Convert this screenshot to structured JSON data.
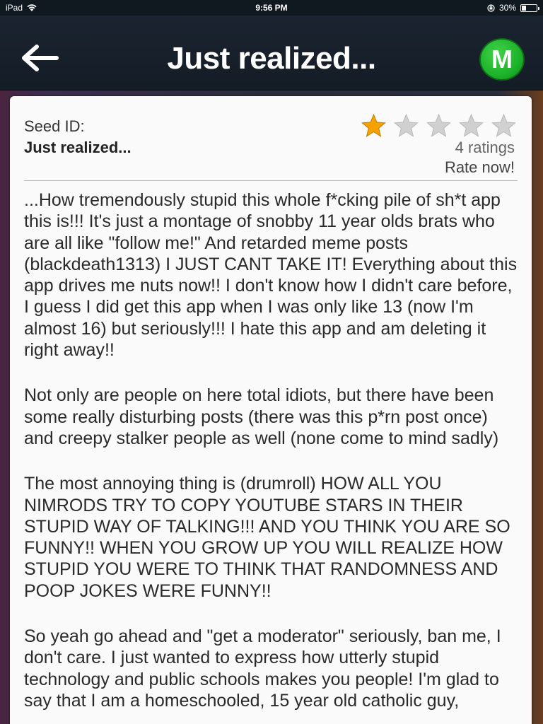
{
  "status_bar": {
    "device": "iPad",
    "time": "9:56 PM",
    "battery": "30%",
    "battery_level": 0.3
  },
  "nav": {
    "title": "Just realized...",
    "back_icon": "left-arrow-icon",
    "logo_letter": "M",
    "logo_color": "#1db32a"
  },
  "seed": {
    "id_label": "Seed ID:",
    "id_value": "Just realized..."
  },
  "rating": {
    "stars_filled": 1,
    "stars_total": 5,
    "count_text": "4 ratings",
    "rate_now": "Rate now!",
    "filled_color": "#f5a100",
    "empty_color": "#d0d0d0"
  },
  "post": {
    "paragraphs": [
      "...How tremendously stupid this whole f*cking pile of sh*t app this is!!! It's just a montage of snobby 11 year olds brats who are all like \"follow me!\" And retarded meme posts (blackdeath1313) I JUST CANT TAKE IT! Everything about this app drives me nuts now!! I don't know how I didn't care before, I guess I did get this app when I was only like 13 (now I'm almost 16) but seriously!!! I hate this app and am deleting it right away!!",
      "Not only are people on here total idiots, but there have been some really disturbing posts (there was this p*rn post once) and creepy stalker people as well (none come to mind sadly)",
      "The most annoying thing is (drumroll) HOW ALL YOU NIMRODS TRY TO COPY YOUTUBE STARS IN THEIR STUPID WAY OF TALKING!!! AND YOU THINK YOU ARE SO FUNNY!! WHEN YOU GROW UP YOU WILL REALIZE HOW STUPID YOU WERE TO THINK THAT RANDOMNESS AND POOP JOKES WERE FUNNY!!",
      "So yeah go ahead and \"get a moderator\" seriously, ban me, I don't care. I just wanted to express how utterly stupid technology and public schools makes you people! I'm glad to say that I am a homeschooled, 15 year old catholic guy,"
    ]
  }
}
